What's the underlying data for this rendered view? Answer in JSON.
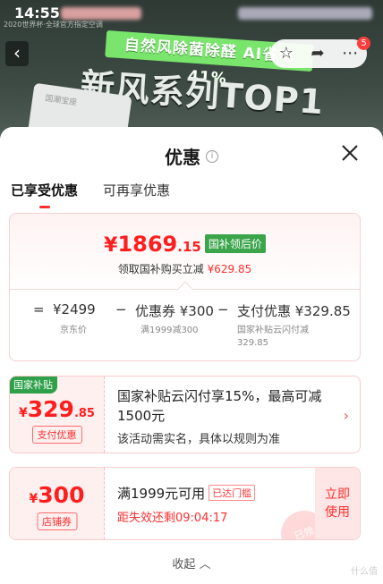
{
  "status_bar": {
    "time": "14:55"
  },
  "banner": {
    "brand_line": "2020世界杯·全球官方指定空调",
    "promo_tagline": "自然风除菌除醛 AI省电41%",
    "promo_headline": "新风系列TOP1",
    "product_label": "国潮宝座",
    "notification_count": "5"
  },
  "sheet": {
    "title": "优惠",
    "tabs": [
      {
        "label": "已享受优惠",
        "active": true
      },
      {
        "label": "可再享优惠",
        "active": false
      }
    ],
    "price_card": {
      "currency": "¥",
      "price_int": "1869",
      "price_dec": ".15",
      "price_tag": "国补领后价",
      "subtitle_prefix": "领取国补购买立减",
      "subtitle_amount": "¥629.85",
      "formula": {
        "equals": "=",
        "jd_price": "¥2499",
        "jd_caption": "京东价",
        "minus1": "−",
        "coupon": "优惠券 ¥300",
        "coupon_caption": "满1999减300",
        "minus2": "−",
        "payment": "支付优惠 ¥329.85",
        "payment_caption": "国家补贴云闪付减 329.85"
      }
    },
    "subsidy_coupon": {
      "badge": "国家补贴",
      "currency": "¥",
      "amount_int": "329",
      "amount_dec": ".85",
      "label": "支付优惠",
      "description": "国家补贴云闪付享15%，最高可减1500元",
      "note": "该活动需实名，具体以规则为准"
    },
    "store_coupon": {
      "currency": "¥",
      "amount": "300",
      "label": "店铺券",
      "condition": "满1999元可用",
      "met_tag": "已达门槛",
      "countdown": "距失效还剩09:04:17",
      "use_button": "立即使用",
      "stamp": "已领"
    },
    "collapse_label": "收起",
    "watermark": "什么值"
  },
  "colors": {
    "accent_red": "#ff1e1e",
    "subsidy_green": "#3aa54b",
    "promo_green": "#7ae56c"
  }
}
